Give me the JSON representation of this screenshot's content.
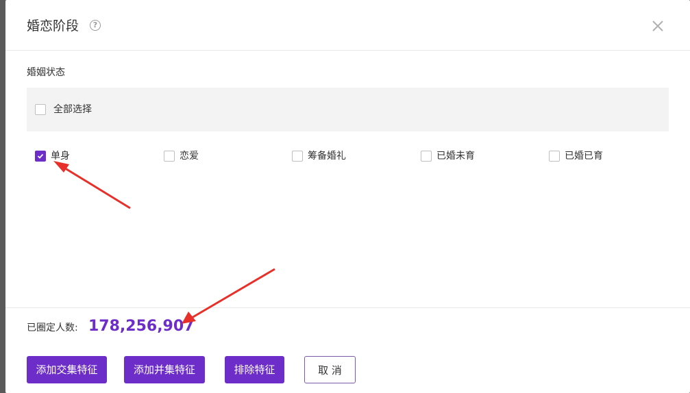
{
  "dialog": {
    "title": "婚恋阶段",
    "help_icon": "question-circle-icon",
    "close_icon": "close-x-icon"
  },
  "section": {
    "label": "婚姻状态",
    "select_all": {
      "label": "全部选择",
      "checked": false
    },
    "options": [
      {
        "label": "单身",
        "checked": true
      },
      {
        "label": "恋爱",
        "checked": false
      },
      {
        "label": "筹备婚礼",
        "checked": false
      },
      {
        "label": "已婚未育",
        "checked": false
      },
      {
        "label": "已婚已育",
        "checked": false
      }
    ]
  },
  "footer": {
    "count_label": "已圈定人数:",
    "count_value": "178,256,907",
    "buttons": {
      "add_intersection": "添加交集特征",
      "add_union": "添加并集特征",
      "exclude": "排除特征",
      "cancel": "取 消"
    }
  },
  "colors": {
    "accent": "#6d2dc8",
    "annotation_arrow": "#e8302a"
  }
}
